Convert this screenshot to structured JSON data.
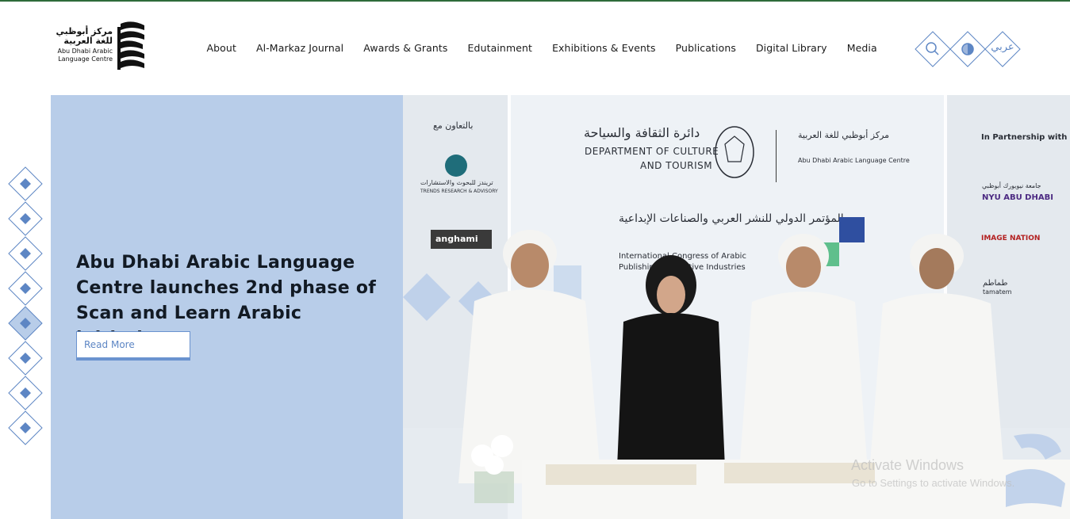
{
  "header": {
    "logo": {
      "line_ar_1": "مركز أبوظبي",
      "line_ar_2": "للغة العربية",
      "line_en_1": "Abu Dhabi Arabic",
      "line_en_2": "Language Centre"
    },
    "nav": [
      {
        "label": "About"
      },
      {
        "label": "Al-Markaz Journal"
      },
      {
        "label": "Awards & Grants"
      },
      {
        "label": "Edutainment"
      },
      {
        "label": "Exhibitions & Events"
      },
      {
        "label": "Publications"
      },
      {
        "label": "Digital Library"
      },
      {
        "label": "Media"
      }
    ],
    "tools": {
      "search_icon": "search-icon",
      "contrast_icon": "contrast-icon",
      "language_label": "عربي"
    }
  },
  "hero": {
    "title": "Abu Dhabi Arabic Language Centre launches 2nd phase of Scan and Learn Arabic initiative",
    "read_more_label": "Read More",
    "slide_count": 8,
    "active_slide": 5,
    "photo": {
      "dept_ar": "دائرة الثقافة والسياحة",
      "dept_en_1": "DEPARTMENT OF CULTURE",
      "dept_en_2": "AND TOURISM",
      "alm_ar": "مركز أبوظبي للغة العربية",
      "alm_en": "Abu Dhabi Arabic Language Centre",
      "congress_ar": "المؤتمر الدولي للنشر العربي والصناعات الإبداعية",
      "congress_en_1": "International Congress of Arabic",
      "congress_en_2": "Publishing & Creative Industries",
      "coop_ar": "بالتعاون مع",
      "trends_ar": "تريندز للبحوث والاستشارات",
      "trends_en": "TRENDS RESEARCH & ADVISORY",
      "anghami": "anghami",
      "partner_en": "In Partnership with",
      "nyu_ar": "جامعة نيويورك أبوظبي",
      "nyu_en": "NYU ABU DHABI",
      "imagenation": "IMAGE NATION",
      "tamatem_ar": "طماطم",
      "tamatem_en": "tamatem"
    }
  },
  "overlay": {
    "activate_title": "Activate Windows",
    "activate_sub": "Go to Settings to activate Windows."
  },
  "colors": {
    "accent": "#5d86c4",
    "panel": "#b8cde9",
    "top_line": "#2e6b3a"
  }
}
